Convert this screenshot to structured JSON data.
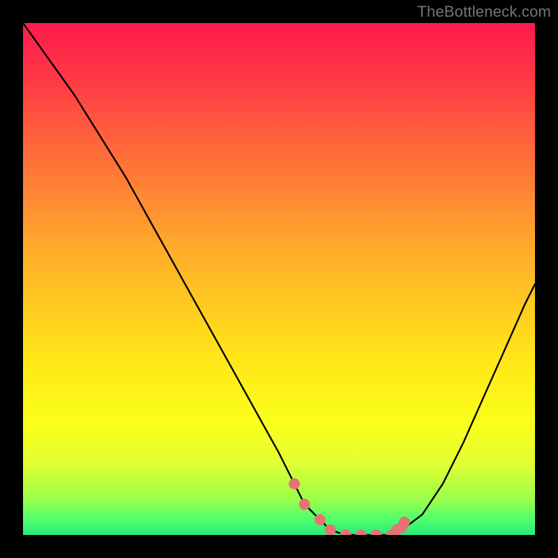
{
  "attribution": "TheBottleneck.com",
  "colors": {
    "frame": "#000000",
    "curve_stroke": "#000000",
    "marker_fill": "#e57373",
    "gradient_stops": [
      "#ff1a4d",
      "#ff3646",
      "#ff6a3a",
      "#ffae2a",
      "#ffe518",
      "#faff1a",
      "#e1ff33",
      "#9bff4a",
      "#4eff6c",
      "#2be87b"
    ]
  },
  "chart_data": {
    "type": "line",
    "title": "",
    "xlabel": "",
    "ylabel": "",
    "xlim": [
      0,
      100
    ],
    "ylim": [
      0,
      100
    ],
    "series": [
      {
        "name": "bottleneck-curve",
        "x": [
          0,
          5,
          10,
          15,
          20,
          25,
          30,
          35,
          40,
          45,
          50,
          53,
          55,
          58,
          60,
          63,
          66,
          69,
          72,
          74,
          78,
          82,
          86,
          90,
          94,
          98,
          100
        ],
        "y": [
          100,
          93,
          86,
          78,
          70,
          61,
          52,
          43,
          34,
          25,
          16,
          10,
          6,
          3,
          1,
          0,
          0,
          0,
          0,
          1,
          4,
          10,
          18,
          27,
          36,
          45,
          49
        ]
      }
    ],
    "markers": {
      "name": "highlight-points",
      "x": [
        53,
        55,
        58,
        60,
        63,
        66,
        69,
        72,
        73,
        74,
        74.5
      ],
      "y": [
        10,
        6,
        3,
        1,
        0,
        0,
        0,
        0,
        1,
        1.5,
        2.5
      ]
    }
  }
}
